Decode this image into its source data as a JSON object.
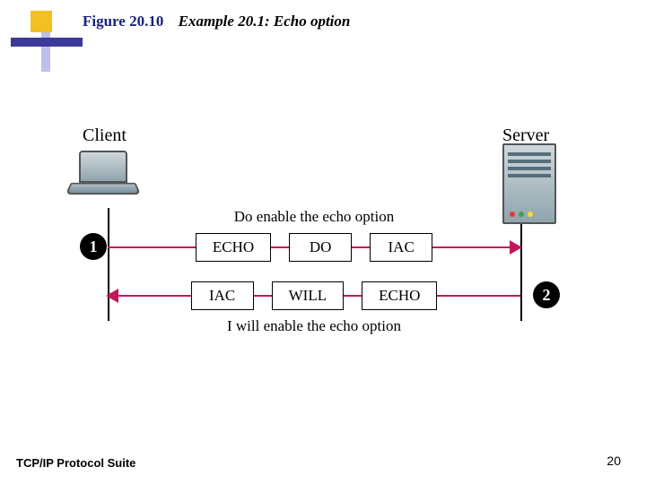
{
  "figure_number": "Figure 20.10",
  "figure_title": "Example 20.1: Echo option",
  "client_label": "Client",
  "server_label": "Server",
  "msg_top": "Do enable the echo option",
  "msg_bottom": "I will enable the echo option",
  "row1": {
    "a": "ECHO",
    "b": "DO",
    "c": "IAC"
  },
  "row2": {
    "a": "IAC",
    "b": "WILL",
    "c": "ECHO"
  },
  "step1": "1",
  "step2": "2",
  "footer_source": "TCP/IP Protocol Suite",
  "page_number": "20"
}
